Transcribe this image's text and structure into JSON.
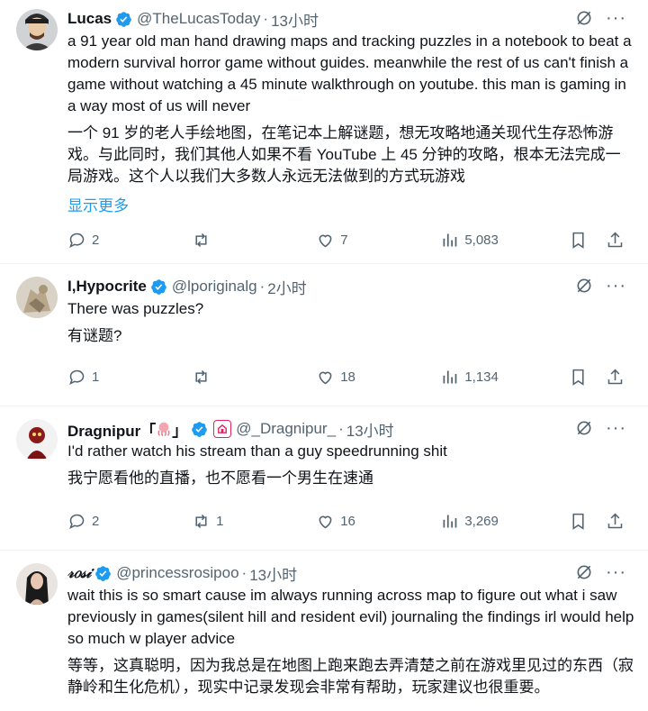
{
  "tweets": [
    {
      "name": "Lucas",
      "handle": "@TheLucasToday",
      "dot": "·",
      "time": "13小时",
      "text": "a 91 year old man hand drawing maps and tracking puzzles in a notebook to beat a modern survival horror game without guides. meanwhile the rest of us can't finish a game without watching a 45 minute walkthrough on youtube. this man is gaming in a way most of us will never",
      "text_cn": "一个 91 岁的老人手绘地图，在笔记本上解谜题，想无攻略地通关现代生存恐怖游戏。与此同时，我们其他人如果不看 YouTube 上 45 分钟的攻略，根本无法完成一局游戏。这个人以我们大多数人永远无法做到的方式玩游戏",
      "show_more": "显示更多",
      "replies": "2",
      "retweets": "",
      "likes": "7",
      "views": "5,083"
    },
    {
      "name": "I,Hypocrite",
      "handle": "@lporiginalg",
      "dot": "·",
      "time": "2小时",
      "text": "There was puzzles?",
      "text_cn": "有谜题?",
      "replies": "1",
      "retweets": "",
      "likes": "18",
      "views": "1,134"
    },
    {
      "name": "Dragnipur「",
      "name_suffix": "」",
      "handle": "@_Dragnipur_",
      "dot": "·",
      "time": "13小时",
      "text": "I'd rather watch his stream than a guy speedrunning shit",
      "text_cn": "我宁愿看他的直播，也不愿看一个男生在速通",
      "replies": "2",
      "retweets": "1",
      "likes": "16",
      "views": "3,269"
    },
    {
      "name": "𝓇𝑜𝓈𝒾",
      "handle": "@princessrosipoo",
      "dot": "·",
      "time": "13小时",
      "text": "wait this is so smart cause im always running across map to figure out what i saw previously in games(silent hill and resident evil) journaling the findings irl would help so much w player advice",
      "text_cn": "等等，这真聪明，因为我总是在地图上跑来跑去弄清楚之前在游戏里见过的东西（寂静岭和生化危机），现实中记录发现会非常有帮助，玩家建议也很重要。"
    }
  ],
  "colors": {
    "verified": "#1d9bf0",
    "link": "#1d9bf0",
    "muted": "#536471"
  }
}
